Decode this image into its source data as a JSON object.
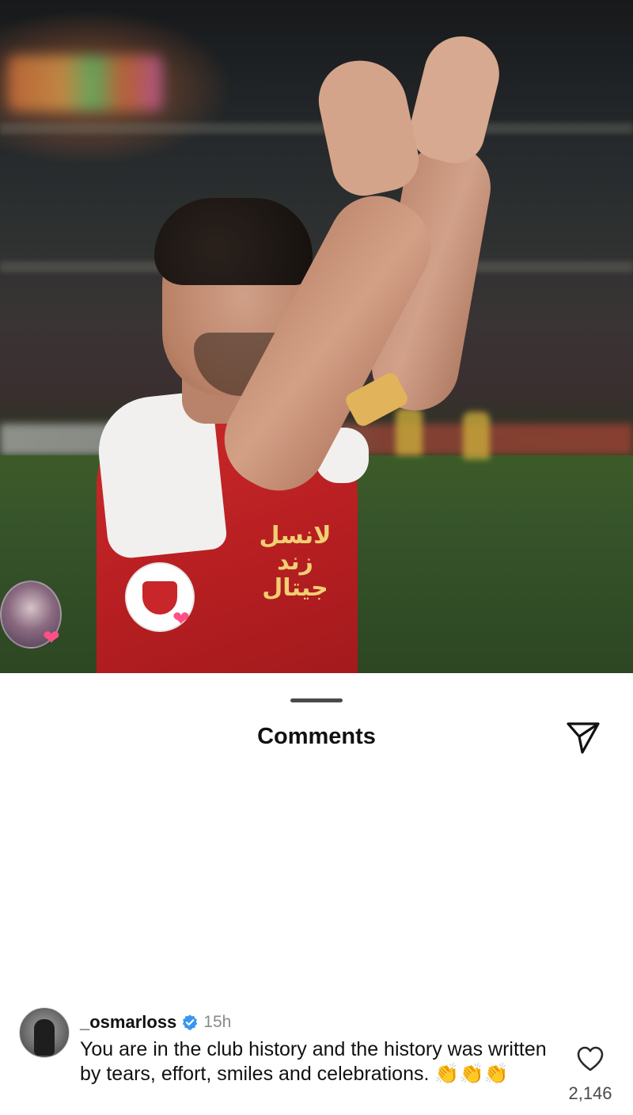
{
  "sheet": {
    "title": "Comments"
  },
  "photo": {
    "sponsor_text": "لانسل\nزند\nجیتال",
    "reaction_heart": "❤"
  },
  "comment": {
    "username": "_osmarloss",
    "verified": true,
    "time": "15h",
    "text": "You are in the club history and the history was written by tears, effort, smiles and celebrations. 👏👏👏",
    "like_count": "2,146"
  },
  "icons": {
    "share": "paper-plane-icon",
    "verified": "verified-badge-icon",
    "like": "heart-outline-icon",
    "reaction": "heart-filled-icon"
  },
  "colors": {
    "verified_blue": "#3897f0",
    "reaction_pink": "#ff4f86",
    "jersey_red": "#c8262a"
  }
}
